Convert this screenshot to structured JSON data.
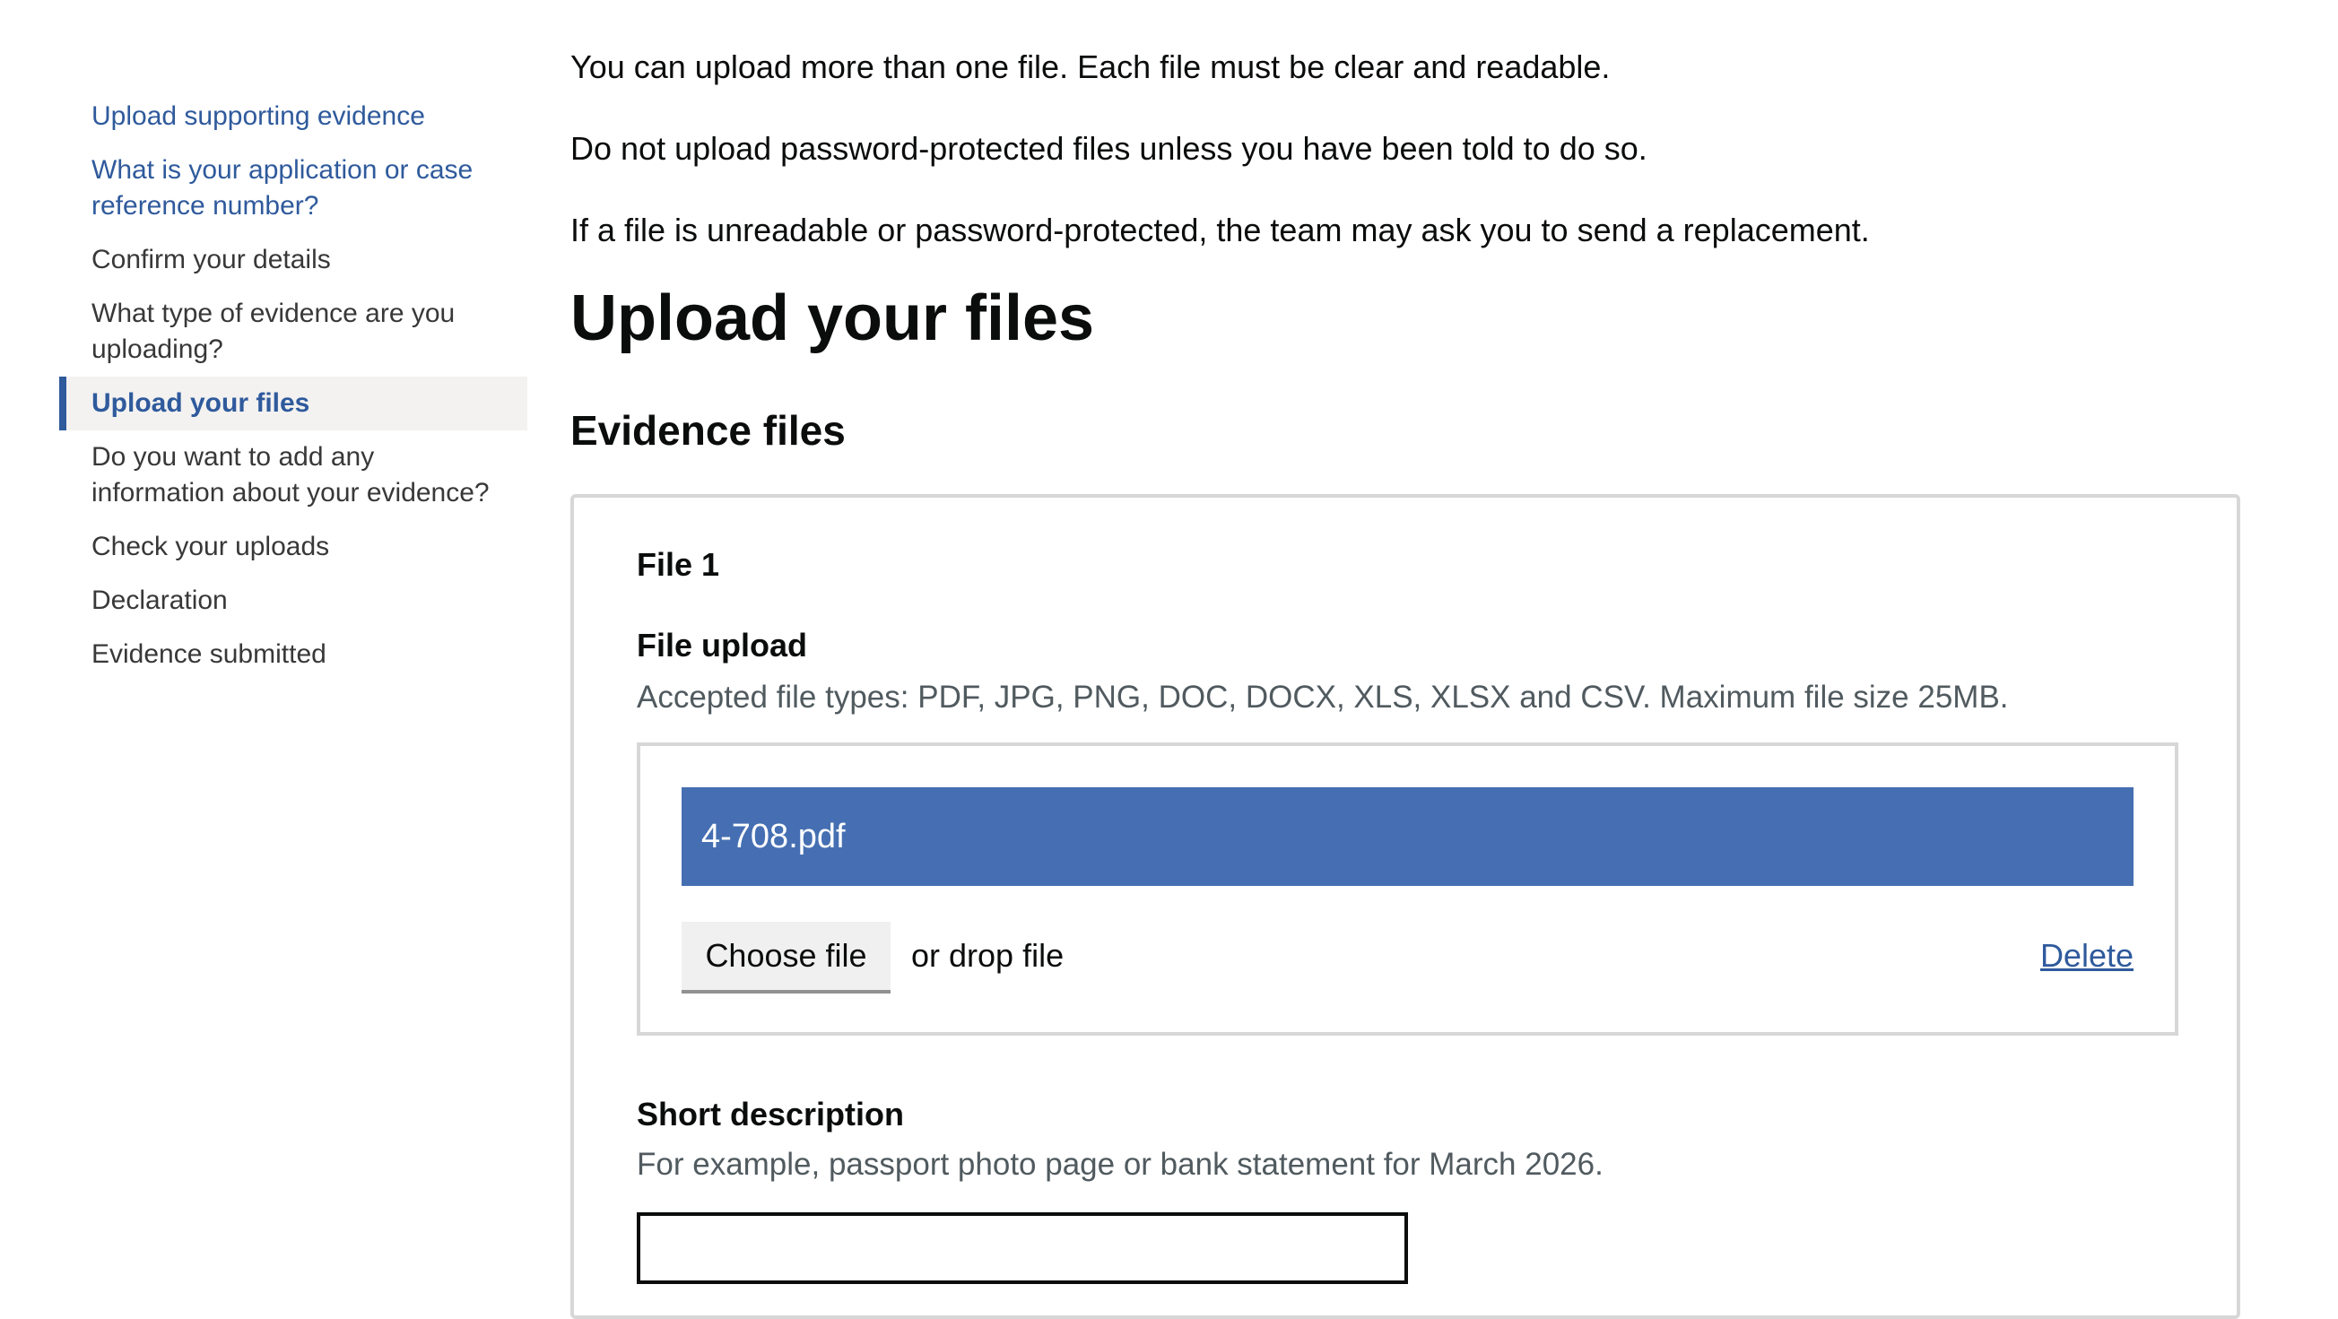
{
  "sidebar": {
    "items": [
      {
        "label": "Upload supporting evidence",
        "state": "link"
      },
      {
        "label": "What is your application or case reference number?",
        "state": "link"
      },
      {
        "label": "Confirm your details",
        "state": "plain"
      },
      {
        "label": "What type of evidence are you uploading?",
        "state": "plain"
      },
      {
        "label": "Upload your files",
        "state": "active"
      },
      {
        "label": "Do you want to add any information about your evidence?",
        "state": "plain"
      },
      {
        "label": "Check your uploads",
        "state": "plain"
      },
      {
        "label": "Declaration",
        "state": "plain"
      },
      {
        "label": "Evidence submitted",
        "state": "plain"
      }
    ]
  },
  "intro": {
    "p1": "You can upload more than one file. Each file must be clear and readable.",
    "p2": "Do not upload password-protected files unless you have been told to do so.",
    "p3": "If a file is unreadable or password-protected, the team may ask you to send a replacement."
  },
  "page": {
    "title": "Upload your files",
    "section_heading": "Evidence files"
  },
  "file_card": {
    "title": "File 1",
    "upload_label": "File upload",
    "upload_hint": "Accepted file types: PDF, JPG, PNG, DOC, DOCX, XLS, XLSX and CSV. Maximum file size 25MB.",
    "selected_file": "4-708.pdf",
    "choose_button": "Choose file",
    "drop_text": "or drop file",
    "delete_link": "Delete",
    "description_label": "Short description",
    "description_hint": "For example, passport photo page or bank statement for March 2026.",
    "description_value": ""
  },
  "colors": {
    "link": "#2f5a9c",
    "file_bar": "#456fb2",
    "active_bg": "#f3f2f1"
  }
}
